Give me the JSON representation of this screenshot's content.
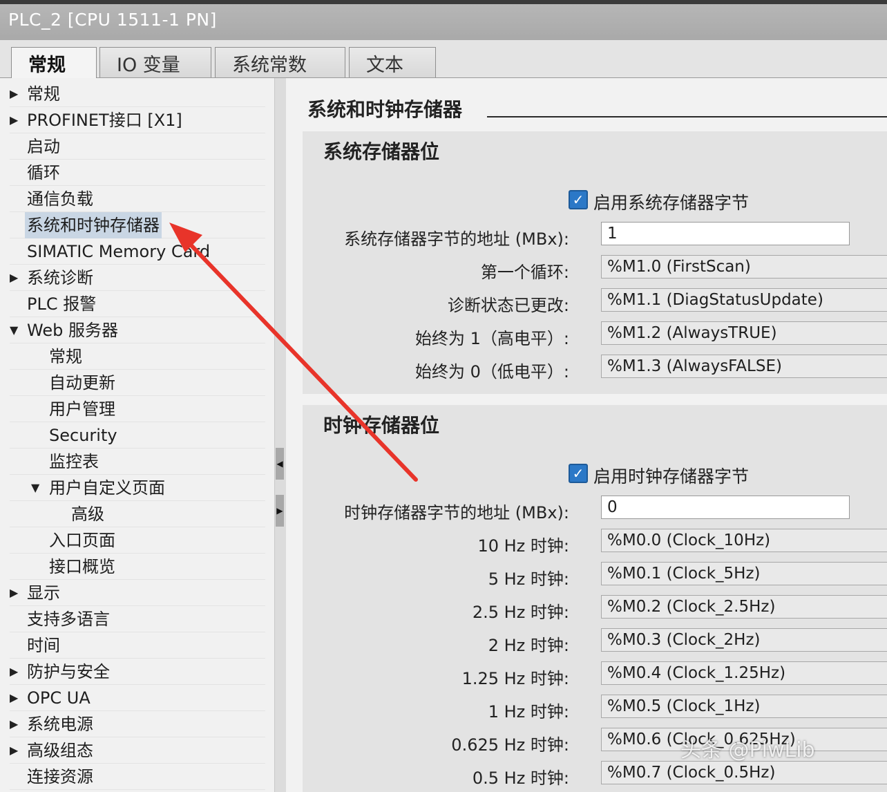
{
  "window": {
    "title": "PLC_2 [CPU 1511-1 PN]"
  },
  "tabs": [
    {
      "label": "常规",
      "active": true
    },
    {
      "label": "IO 变量"
    },
    {
      "label": "系统常数"
    },
    {
      "label": "文本"
    }
  ],
  "tree": [
    {
      "label": "常规",
      "arrow": "▶"
    },
    {
      "label": "PROFINET接口 [X1]",
      "arrow": "▶"
    },
    {
      "label": "启动"
    },
    {
      "label": "循环"
    },
    {
      "label": "通信负载"
    },
    {
      "label": "系统和时钟存储器",
      "selected": true
    },
    {
      "label": "SIMATIC Memory Card"
    },
    {
      "label": "系统诊断",
      "arrow": "▶"
    },
    {
      "label": "PLC 报警"
    },
    {
      "label": "Web 服务器",
      "arrow": "▼"
    },
    {
      "label": "常规"
    },
    {
      "label": "自动更新"
    },
    {
      "label": "用户管理"
    },
    {
      "label": "Security"
    },
    {
      "label": "监控表"
    },
    {
      "label": "用户自定义页面",
      "arrow": "▼"
    },
    {
      "label": "高级"
    },
    {
      "label": "入口页面"
    },
    {
      "label": "接口概览"
    },
    {
      "label": "显示",
      "arrow": "▶"
    },
    {
      "label": "支持多语言"
    },
    {
      "label": "时间"
    },
    {
      "label": "防护与安全",
      "arrow": "▶"
    },
    {
      "label": "OPC UA",
      "arrow": "▶"
    },
    {
      "label": "系统电源",
      "arrow": "▶"
    },
    {
      "label": "高级组态",
      "arrow": "▶"
    },
    {
      "label": "连接资源"
    }
  ],
  "splitter": {
    "collapse_glyph": "◀",
    "expand_glyph": "▶"
  },
  "main": {
    "title": "系统和时钟存储器",
    "system": {
      "title": "系统存储器位",
      "enable_checked": true,
      "enable_label": "启用系统存储器字节",
      "address_label": "系统存储器字节的地址 (MBx):",
      "address_value": "1",
      "rows": [
        {
          "label": "第一个循环:",
          "value": "%M1.0 (FirstScan)"
        },
        {
          "label": "诊断状态已更改:",
          "value": "%M1.1 (DiagStatusUpdate)"
        },
        {
          "label": "始终为 1（高电平）:",
          "value": "%M1.2 (AlwaysTRUE)"
        },
        {
          "label": "始终为 0（低电平）:",
          "value": "%M1.3 (AlwaysFALSE)"
        }
      ]
    },
    "clock": {
      "title": "时钟存储器位",
      "enable_checked": true,
      "enable_label": "启用时钟存储器字节",
      "address_label": "时钟存储器字节的地址 (MBx):",
      "address_value": "0",
      "rows": [
        {
          "label": "10 Hz 时钟:",
          "value": "%M0.0 (Clock_10Hz)"
        },
        {
          "label": "5 Hz 时钟:",
          "value": "%M0.1 (Clock_5Hz)"
        },
        {
          "label": "2.5 Hz 时钟:",
          "value": "%M0.2 (Clock_2.5Hz)"
        },
        {
          "label": "2 Hz 时钟:",
          "value": "%M0.3 (Clock_2Hz)"
        },
        {
          "label": "1.25 Hz 时钟:",
          "value": "%M0.4 (Clock_1.25Hz)"
        },
        {
          "label": "1 Hz 时钟:",
          "value": "%M0.5 (Clock_1Hz)"
        },
        {
          "label": "0.625 Hz 时钟:",
          "value": "%M0.6 (Clock_0.625Hz)"
        },
        {
          "label": "0.5 Hz 时钟:",
          "value": "%M0.7 (Clock_0.5Hz)"
        }
      ]
    }
  },
  "watermark": "头条 @PlwLib",
  "annotation": {
    "arrow_color": "#e8342a"
  }
}
